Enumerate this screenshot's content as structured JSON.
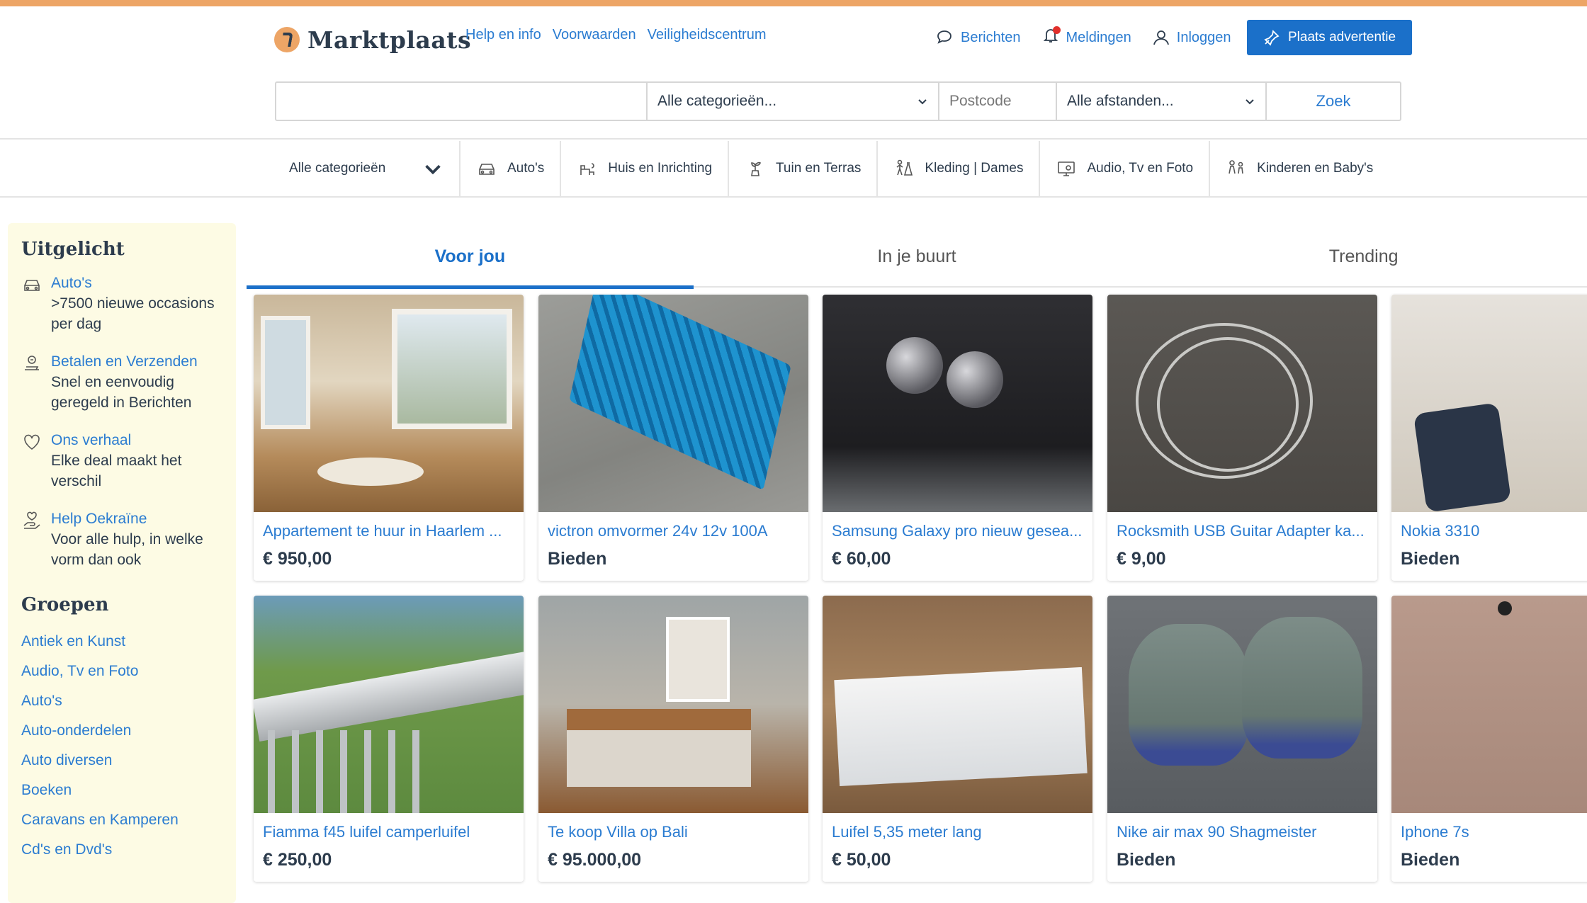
{
  "brand": {
    "name": "Marktplaats",
    "accent": "#eda566",
    "blue": "#1b70c9",
    "link": "#2b7cd1"
  },
  "header": {
    "links": [
      "Help en info",
      "Voorwaarden",
      "Veiligheidscentrum"
    ],
    "berichten": "Berichten",
    "meldingen": "Meldingen",
    "inloggen": "Inloggen",
    "place_ad": "Plaats advertentie"
  },
  "search": {
    "query_value": "",
    "category": "Alle categorieën...",
    "postcode_placeholder": "Postcode",
    "distance": "Alle afstanden...",
    "submit": "Zoek"
  },
  "catnav": {
    "all": "Alle categorieën",
    "items": [
      {
        "label": "Auto's",
        "icon": "car-icon"
      },
      {
        "label": "Huis en Inrichting",
        "icon": "furniture-icon"
      },
      {
        "label": "Tuin en Terras",
        "icon": "plant-icon"
      },
      {
        "label": "Kleding | Dames",
        "icon": "clothing-icon"
      },
      {
        "label": "Audio, Tv en Foto",
        "icon": "tv-icon"
      },
      {
        "label": "Kinderen en Baby's",
        "icon": "kids-icon"
      }
    ]
  },
  "sidebar": {
    "featured_heading": "Uitgelicht",
    "featured": [
      {
        "title": "Auto's",
        "desc": ">7500 nieuwe occasions per dag",
        "icon": "car-icon"
      },
      {
        "title": "Betalen en Verzenden",
        "desc": "Snel en eenvoudig geregeld in Berichten",
        "icon": "payment-icon"
      },
      {
        "title": "Ons verhaal",
        "desc": "Elke deal maakt het verschil",
        "icon": "heart-icon"
      },
      {
        "title": "Help Oekraïne",
        "desc": "Voor alle hulp, in welke vorm dan ook",
        "icon": "helping-hand-icon"
      }
    ],
    "groups_heading": "Groepen",
    "groups": [
      "Antiek en Kunst",
      "Audio, Tv en Foto",
      "Auto's",
      "Auto-onderdelen",
      "Auto diversen",
      "Boeken",
      "Caravans en Kamperen",
      "Cd's en Dvd's"
    ]
  },
  "tabs": [
    {
      "label": "Voor jou",
      "active": true
    },
    {
      "label": "In je buurt",
      "active": false
    },
    {
      "label": "Trending",
      "active": false
    }
  ],
  "listings": [
    {
      "title": "Appartement te huur in Haarlem ...",
      "price": "€ 950,00",
      "photo": "ph-apt"
    },
    {
      "title": "victron omvormer 24v 12v 100A",
      "price": "Bieden",
      "photo": "ph-amp"
    },
    {
      "title": "Samsung Galaxy pro nieuw gesea...",
      "price": "€ 60,00",
      "photo": "ph-buds"
    },
    {
      "title": "Rocksmith USB Guitar Adapter ka...",
      "price": "€ 9,00",
      "photo": "ph-cable"
    },
    {
      "title": "Nokia 3310",
      "price": "Bieden",
      "photo": "ph-nokia"
    },
    {
      "title": "Fiamma f45 luifel camperluifel",
      "price": "€ 250,00",
      "photo": "ph-awning"
    },
    {
      "title": "Te koop Villa op Bali",
      "price": "€ 95.000,00",
      "photo": "ph-bed"
    },
    {
      "title": "Luifel 5,35 meter lang",
      "price": "€ 50,00",
      "photo": "ph-luifel"
    },
    {
      "title": "Nike air max 90 Shagmeister",
      "price": "Bieden",
      "photo": "ph-shoe"
    },
    {
      "title": "Iphone 7s",
      "price": "Bieden",
      "photo": "ph-iphone"
    }
  ]
}
